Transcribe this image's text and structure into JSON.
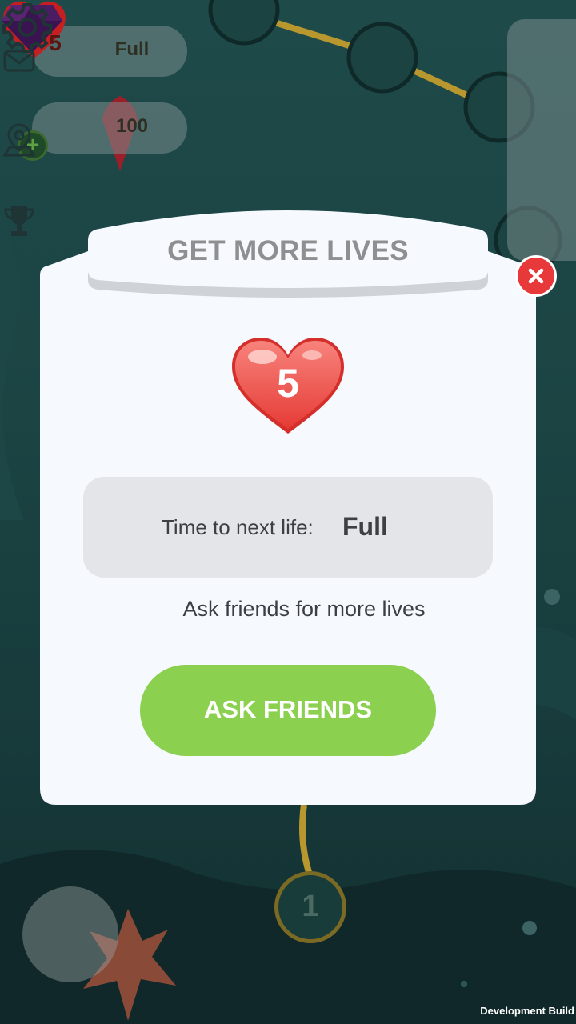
{
  "hud": {
    "lives_count": "5",
    "lives_status": "Full",
    "gems_count": "100",
    "add_gems_symbol": "+"
  },
  "side_menu": {
    "icons": [
      "mail-icon",
      "map-pin-icon",
      "trophy-icon"
    ]
  },
  "map": {
    "current_level": "1"
  },
  "dialog": {
    "title": "GET MORE LIVES",
    "lives_count": "5",
    "timer_label": "Time to next life:",
    "timer_value": "Full",
    "ask_text": "Ask friends for more lives",
    "ask_button_label": "ASK FRIENDS"
  },
  "footer": {
    "build_label": "Development Build"
  },
  "colors": {
    "accent_green": "#8bd04f",
    "close_red": "#e8393a",
    "heart_red": "#e9504c",
    "dialog_bg": "#f6f9fd"
  }
}
